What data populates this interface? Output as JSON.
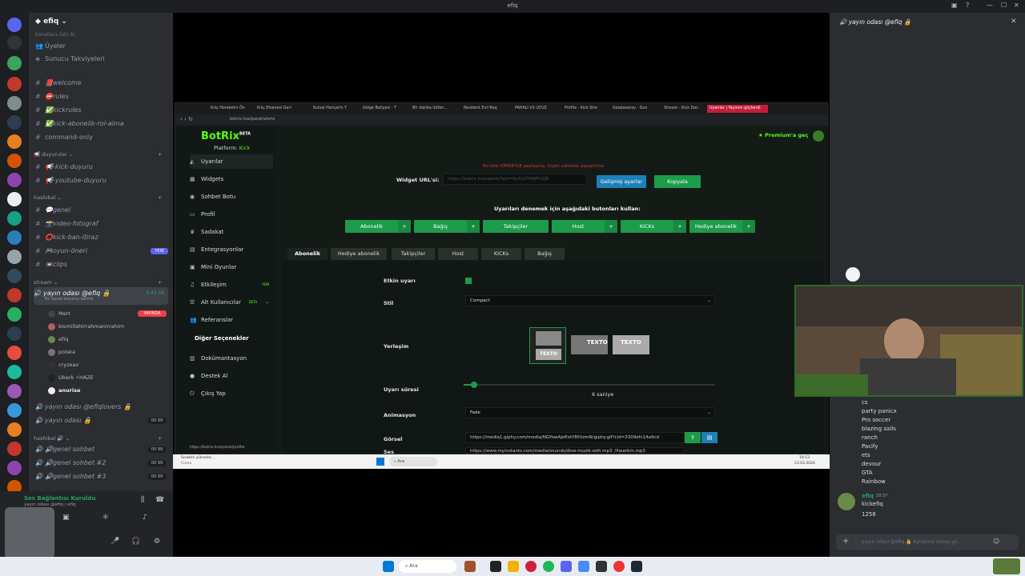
{
  "window": {
    "title": "efiq"
  },
  "server": {
    "name": "efiq"
  },
  "sidebar": {
    "top_items": [
      {
        "label": "Kanallara Göz At"
      },
      {
        "label": "Üyeler"
      },
      {
        "label": "Sunucu Takviyeleri"
      }
    ],
    "text_channels": [
      {
        "label": "📕welcome"
      },
      {
        "label": "⛔rules"
      },
      {
        "label": "✅kickrules"
      },
      {
        "label": "✅kick-abonelik-rol-alma"
      },
      {
        "label": "command-only"
      }
    ],
    "cat_duyurular": "duyurular",
    "duyuru_channels": [
      {
        "label": "📢-kick-duyuru"
      },
      {
        "label": "📢-youtube-duyuru"
      }
    ],
    "cat_hashibal": "hashibal",
    "hashibal_channels": [
      {
        "label": "💬genel"
      },
      {
        "label": "📸video-fotograf"
      },
      {
        "label": "⭕kick-ban-itiraz"
      },
      {
        "label": "🎮oyun-öneri",
        "badge": "YENİ"
      },
      {
        "label": "📼clips"
      }
    ],
    "cat_stream": "stream",
    "stream_channel": {
      "label": "yayın odası @efiq 🔒",
      "time": "3:43:56",
      "sub": "Bir kanal durumu belirle",
      "badge": "YAYINDA"
    },
    "voice_users": [
      {
        "name": "Mert"
      },
      {
        "name": "bismillahirrahmanirrahim"
      },
      {
        "name": "efiq"
      },
      {
        "name": "polska"
      },
      {
        "name": "cryzeax"
      },
      {
        "name": "Uberk ⚡HAZE"
      },
      {
        "name": "anurise"
      }
    ],
    "other_voice": [
      {
        "label": "yayın odası @efiqlovers 🔒"
      },
      {
        "label": "yayın odası 🔒",
        "count": "00 99"
      }
    ],
    "cat_hashibal2": "hashibal 🔊",
    "voice_channels": [
      {
        "label": "🔊genel sohbet",
        "count": "00 99"
      },
      {
        "label": "🔊genel sohbet #2",
        "count": "00 99"
      },
      {
        "label": "🔊genel sohbet #3",
        "count": "00 99"
      }
    ]
  },
  "userpanel": {
    "status": "Ses Bağlantısı Kuruldu",
    "sub": "yayın odası @efiq / efiq"
  },
  "browser": {
    "tabs": [
      "Kılıç Hareketin Ön",
      "Kılıç Efsanesi Geri",
      "Kutsal Hançerin Y",
      "Gölge Bahçesi - T",
      "Bir dakika lütfen...",
      "Resident Evil Req",
      "PAHALI VS UCUZ",
      "Profile - Kick Stre",
      "Galatasaray - Goo",
      "Stream - Kick Das",
      "Uyarılar | Yayınını güçlendi"
    ],
    "url": "botrix.live/panel/alerts",
    "status_url": "https://botrix.live/panel/profile"
  },
  "botrix": {
    "logo": "BotRix",
    "beta": "BETA",
    "platform_label": "Platform:",
    "platform_value": "Kick",
    "premium": "Premium'a geç",
    "nav": [
      {
        "label": "Uyarılar",
        "icon": "alert-icon"
      },
      {
        "label": "Widgets",
        "icon": "widgets-icon"
      },
      {
        "label": "Sohbet Botu",
        "icon": "bot-icon"
      },
      {
        "label": "Profil",
        "icon": "profile-icon"
      },
      {
        "label": "Sadakat",
        "icon": "loyalty-icon"
      },
      {
        "label": "Entegrasyonlar",
        "icon": "integrations-icon"
      },
      {
        "label": "Mini Oyunlar",
        "icon": "games-icon"
      },
      {
        "label": "Etkileşim",
        "icon": "music-icon",
        "badge": "YENİ"
      },
      {
        "label": "Alt Kullanıcılar",
        "icon": "subusers-icon",
        "badge": "BETA"
      },
      {
        "label": "Referanslar",
        "icon": "referrals-icon"
      }
    ],
    "other_header": "Diğer Seçenekler",
    "other_nav": [
      {
        "label": "Dokümantasyon"
      },
      {
        "label": "Destek Al"
      },
      {
        "label": "Çıkış Yap"
      }
    ],
    "warning": "Bu linki KİMSEYLE paylaşma, hiçbir sohbete yapıştırma",
    "widget_label": "Widget URL'si:",
    "widget_value": "https://botrix.live/alerts?bid=4uYLDT4WFh1JB",
    "advanced_btn": "Gelişmiş ayarlar",
    "copy_btn": "Kopyala",
    "test_header": "Uyarıları denemek için aşağıdaki butonları kullan:",
    "test_buttons": [
      "Abonelik",
      "Bağış",
      "Takipçiler",
      "Host",
      "KICKs",
      "Hediye abonelik"
    ],
    "tabs": [
      "Abonelik",
      "Hediye abonelik",
      "Takipçiler",
      "Host",
      "KICKs",
      "Bağış"
    ],
    "form": {
      "enabled_label": "Etkin uyarı",
      "style_label": "Stil",
      "style_value": "Compact",
      "layout_label": "Yerleşim",
      "layout_option_text": "TEXTO",
      "duration_label": "Uyarı süresi",
      "duration_value": "6 saniye",
      "duration_fraction": 0.04,
      "animation_label": "Animasyon",
      "animation_value": "Fade",
      "image_label": "Görsel",
      "image_value": "https://media1.giphy.com/media/NGYowAJeEotYRtVzmN/giphy.gif?cid=3309efc14a9cd",
      "sound_label": "Ses",
      "sound_value": "https://www.myinstants.com/media/sounds/dive-muzik-edit.mp3_/Xwarbm.mp3"
    }
  },
  "stream_taskbar": {
    "notice": "Sıcaklık yükselec...",
    "notice_sub": "Cuma",
    "search": "Ara",
    "time": "19:53",
    "date": "23.03.2026"
  },
  "rightpanel": {
    "title": "yayın odası @efiq 🔒",
    "chat_lines": [
      "cs",
      "party panicx",
      "Pro soccer",
      "blazing sails",
      "ranch",
      "Pacify",
      "ets",
      "devour",
      "GTA",
      "Rainbow"
    ],
    "message": {
      "author": "efiq",
      "time": "18:37",
      "lines": [
        "kickefiq",
        "1256"
      ]
    },
    "input_placeholder": "yayın odası @efiq 🔒 Kanalına mesaj gö..."
  },
  "taskbar": {
    "search": "Ara"
  },
  "colors": {
    "kick_green": "#53fc18",
    "button_green": "#1c9c4a",
    "live_red": "#f23f43",
    "blurple": "#5865f2"
  }
}
